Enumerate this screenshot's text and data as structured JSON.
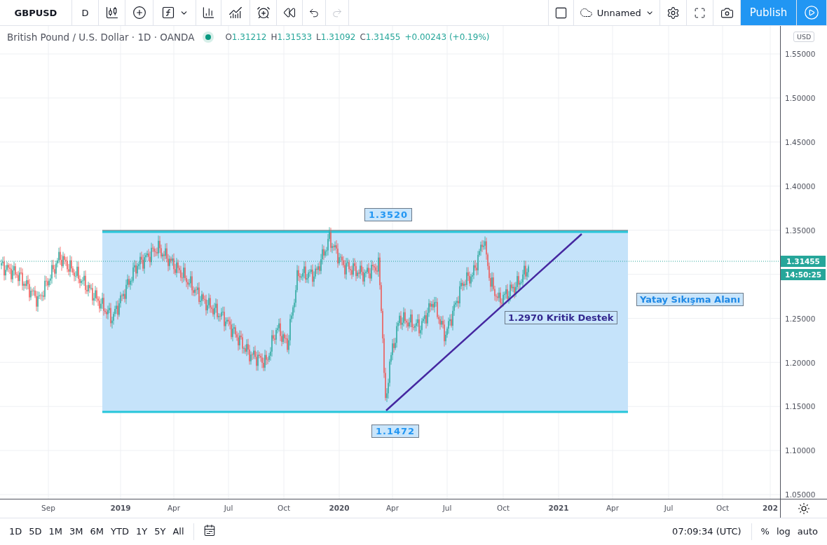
{
  "toolbar": {
    "symbol": "GBPUSD",
    "interval": "D",
    "layout_name": "Unnamed",
    "publish_button": "Publish"
  },
  "legend": {
    "title": "British Pound / U.S. Dollar · 1D · OANDA",
    "market_open": true,
    "ohlc": [
      {
        "label": "O",
        "value": "1.31212"
      },
      {
        "label": "H",
        "value": "1.31533"
      },
      {
        "label": "L",
        "value": "1.31092"
      },
      {
        "label": "C",
        "value": "1.31455"
      }
    ],
    "change": "+0.00243 (+0.19%)"
  },
  "price_axis": {
    "currency": "USD",
    "ticks": [
      "1.55000",
      "1.50000",
      "1.45000",
      "1.40000",
      "1.35000",
      "1.25000",
      "1.20000",
      "1.15000",
      "1.10000",
      "1.05000"
    ],
    "last_price": "1.31455",
    "countdown": "14:50:25"
  },
  "time_axis": {
    "ticks": [
      "Sep",
      "2019",
      "Apr",
      "Jul",
      "Oct",
      "2020",
      "Apr",
      "Jul",
      "Oct",
      "2021",
      "Apr",
      "Jul",
      "Oct",
      "202"
    ]
  },
  "annotations": [
    {
      "kind": "price_label",
      "text": "1.3520"
    },
    {
      "kind": "price_label",
      "text": "1.1472"
    },
    {
      "kind": "note",
      "text": "1.2970 Kritik Destek",
      "color": "#33288f"
    },
    {
      "kind": "note",
      "text": "Yatay Sıkışma Alanı",
      "color": "#1e88e5"
    }
  ],
  "bottom_bar": {
    "ranges": [
      "1D",
      "5D",
      "1M",
      "3M",
      "6M",
      "YTD",
      "1Y",
      "5Y",
      "All"
    ],
    "clock": "07:09:34 (UTC)",
    "options": [
      "%",
      "log",
      "auto"
    ]
  }
}
